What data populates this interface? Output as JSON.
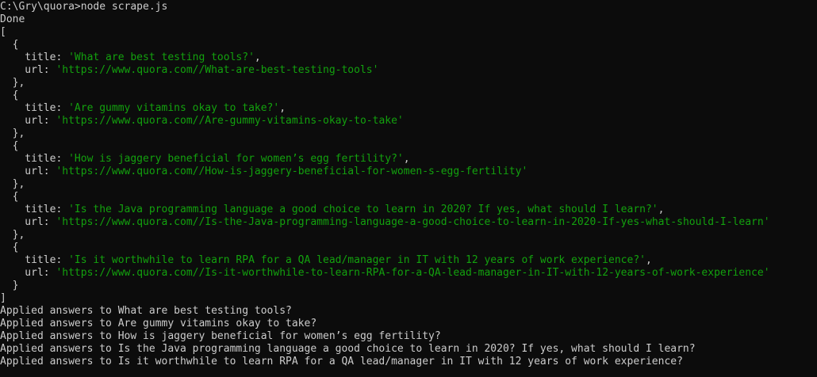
{
  "colors": {
    "background": "#0c0c0c",
    "foreground": "#cccccc",
    "string": "#13a10e"
  },
  "terminal": {
    "lines": [
      {
        "text": "C:\\Gry\\quora>node scrape.js"
      },
      {
        "text": "Done"
      },
      {
        "text": "["
      },
      {
        "text": "  {"
      },
      {
        "text": "    title: ",
        "str": "'What are best testing tools?'",
        "tail": ","
      },
      {
        "text": "    url: ",
        "str": "'https://www.quora.com//What-are-best-testing-tools'",
        "tail": ""
      },
      {
        "text": "  },"
      },
      {
        "text": "  {"
      },
      {
        "text": "    title: ",
        "str": "'Are gummy vitamins okay to take?'",
        "tail": ","
      },
      {
        "text": "    url: ",
        "str": "'https://www.quora.com//Are-gummy-vitamins-okay-to-take'",
        "tail": ""
      },
      {
        "text": "  },"
      },
      {
        "text": "  {"
      },
      {
        "text": "    title: ",
        "str": "'How is jaggery beneficial for women’s egg fertility?'",
        "tail": ","
      },
      {
        "text": "    url: ",
        "str": "'https://www.quora.com//How-is-jaggery-beneficial-for-women-s-egg-fertility'",
        "tail": ""
      },
      {
        "text": "  },"
      },
      {
        "text": "  {"
      },
      {
        "text": "    title: ",
        "str": "'Is the Java programming language a good choice to learn in 2020? If yes, what should I learn?'",
        "tail": ","
      },
      {
        "text": "    url: ",
        "str": "'https://www.quora.com//Is-the-Java-programming-language-a-good-choice-to-learn-in-2020-If-yes-what-should-I-learn'",
        "tail": ""
      },
      {
        "text": "  },"
      },
      {
        "text": "  {"
      },
      {
        "text": "    title: ",
        "str": "'Is it worthwhile to learn RPA for a QA lead/manager in IT with 12 years of work experience?'",
        "tail": ","
      },
      {
        "text": "    url: ",
        "str": "'https://www.quora.com//Is-it-worthwhile-to-learn-RPA-for-a-QA-lead-manager-in-IT-with-12-years-of-work-experience'",
        "tail": ""
      },
      {
        "text": "  }"
      },
      {
        "text": "]"
      },
      {
        "text": "Applied answers to What are best testing tools?"
      },
      {
        "text": "Applied answers to Are gummy vitamins okay to take?"
      },
      {
        "text": "Applied answers to How is jaggery beneficial for women’s egg fertility?"
      },
      {
        "text": "Applied answers to Is the Java programming language a good choice to learn in 2020? If yes, what should I learn?"
      },
      {
        "text": "Applied answers to Is it worthwhile to learn RPA for a QA lead/manager in IT with 12 years of work experience?"
      }
    ]
  }
}
